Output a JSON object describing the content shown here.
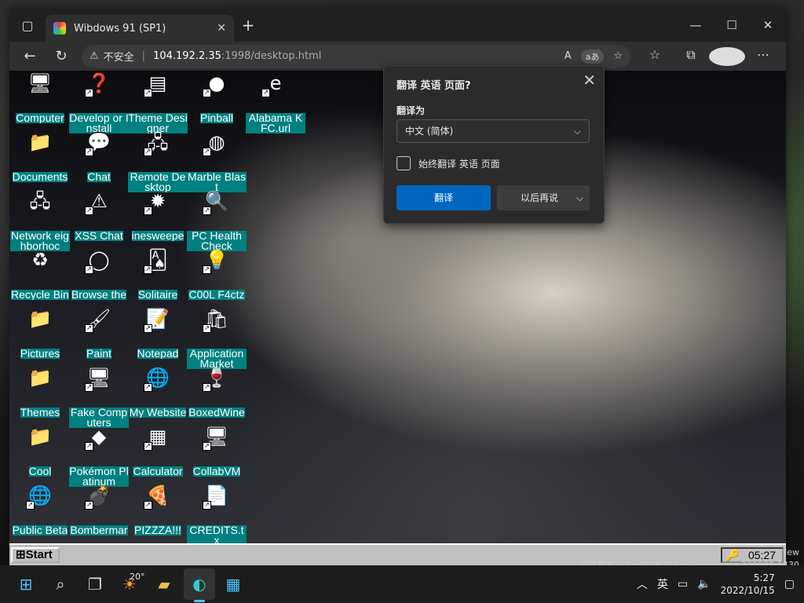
{
  "browser": {
    "tab_title": "Wibdows 91 (SP1)",
    "tab_close": "✕",
    "new_tab": "+",
    "win_minimize": "—",
    "win_maximize": "☐",
    "win_close": "✕",
    "security_label": "不安全",
    "url_host": "104.192.2.35",
    "url_path": ":1998/desktop.html",
    "read_aloud": "A",
    "translate_pill": "aあ"
  },
  "desktop_icons": [
    {
      "label": "Computer",
      "icon": "computer-icon"
    },
    {
      "label": "Develop or Install",
      "icon": "developer-icon"
    },
    {
      "label": "Theme Designer",
      "icon": "theme-designer-icon"
    },
    {
      "label": "Pinball",
      "icon": "pinball-icon"
    },
    {
      "label": "Alabama KFC.url",
      "icon": "ie-url-icon"
    },
    {
      "label": "Documents",
      "icon": "folder-documents-icon"
    },
    {
      "label": "Chat",
      "icon": "chat-icon"
    },
    {
      "label": "Remote Desktop",
      "icon": "remote-desktop-icon"
    },
    {
      "label": "Marble Blast",
      "icon": "marble-icon"
    },
    {
      "label": "Network eighborhoc",
      "icon": "network-icon"
    },
    {
      "label": "XSS Chat",
      "icon": "xss-chat-icon"
    },
    {
      "label": "inesweepe",
      "icon": "minesweeper-icon"
    },
    {
      "label": "PC Health Check",
      "icon": "pc-health-icon"
    },
    {
      "label": "Recycle Bin",
      "icon": "recycle-bin-icon"
    },
    {
      "label": "Browse the",
      "icon": "browser-icon"
    },
    {
      "label": "Solitaire",
      "icon": "solitaire-icon"
    },
    {
      "label": "C00L F4ctz",
      "icon": "cool-facts-icon"
    },
    {
      "label": "Pictures",
      "icon": "folder-icon"
    },
    {
      "label": "Paint",
      "icon": "paint-icon"
    },
    {
      "label": "Notepad",
      "icon": "notepad-icon"
    },
    {
      "label": "Application Market",
      "icon": "app-market-icon"
    },
    {
      "label": "Themes",
      "icon": "folder-icon"
    },
    {
      "label": "Fake Computers",
      "icon": "fake-computers-icon"
    },
    {
      "label": "My Website",
      "icon": "globe-icon"
    },
    {
      "label": "BoxedWine",
      "icon": "boxedwine-icon"
    },
    {
      "label": "Cool",
      "icon": "folder-icon"
    },
    {
      "label": "Pokémon Platinum",
      "icon": "pokemon-icon"
    },
    {
      "label": "Calculator",
      "icon": "calculator-icon"
    },
    {
      "label": "CollabVM",
      "icon": "collabvm-icon"
    },
    {
      "label": "Public Beta",
      "icon": "public-beta-icon"
    },
    {
      "label": "Bombermar",
      "icon": "bomberman-icon"
    },
    {
      "label": "PIZZZA!!!",
      "icon": "pizza-icon"
    },
    {
      "label": "CREDITS.tx",
      "icon": "text-file-icon"
    }
  ],
  "w91_taskbar": {
    "start_label": "Start",
    "clock": "05:27"
  },
  "translate_popup": {
    "title": "翻译 英语 页面?",
    "target_label": "翻译为",
    "target_value": "中文 (简体)",
    "always_label": "始终翻译 英语 页面",
    "translate_button": "翻译",
    "later_button": "以后再说"
  },
  "watermark": {
    "line1": "评估副本。 Build 25201.rs_prerelease.220909-1430",
    "edge_text": "lew"
  },
  "win11_taskbar": {
    "weather": "20°",
    "ime": "英",
    "time": "5:27",
    "date": "2022/10/15"
  },
  "colors": {
    "teal": "#008080",
    "accent": "#0067c0"
  }
}
